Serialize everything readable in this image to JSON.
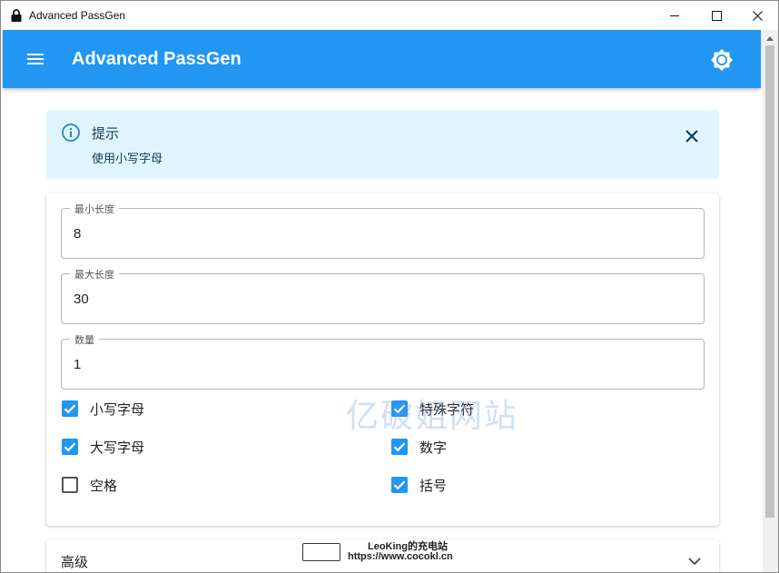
{
  "window": {
    "title": "Advanced PassGen",
    "minimize_icon": "minimize-icon",
    "maximize_icon": "maximize-icon",
    "close_icon": "close-icon"
  },
  "appbar": {
    "title": "Advanced PassGen",
    "color": "#2196f3",
    "menu_icon": "hamburger-menu-icon",
    "theme_icon": "brightness-icon"
  },
  "alert": {
    "title": "提示",
    "message": "使用小写字母",
    "background": "#e1f5fe",
    "icon": "info-icon",
    "close_icon": "close-icon"
  },
  "fields": {
    "min_length": {
      "label": "最小长度",
      "value": "8"
    },
    "max_length": {
      "label": "最大长度",
      "value": "30"
    },
    "amount": {
      "label": "数量",
      "value": "1"
    }
  },
  "options": {
    "lowercase": {
      "label": "小写字母",
      "checked": true
    },
    "special": {
      "label": "特殊字符",
      "checked": true
    },
    "uppercase": {
      "label": "大写字母",
      "checked": true
    },
    "numbers": {
      "label": "数字",
      "checked": true
    },
    "spaces": {
      "label": "空格",
      "checked": false
    },
    "brackets": {
      "label": "括号",
      "checked": true
    }
  },
  "advanced": {
    "title": "高级",
    "icon": "chevron-down-icon"
  },
  "watermark": {
    "main": "亿破姐网站",
    "line1": "LeoKing的充电站",
    "line2": "https://www.cocokl.cn"
  }
}
